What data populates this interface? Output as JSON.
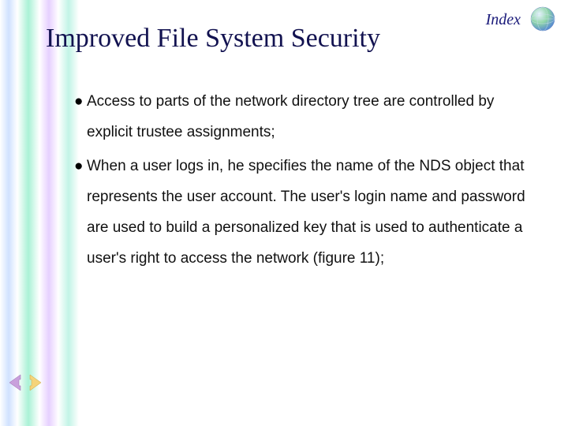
{
  "header": {
    "index_label": "Index",
    "title": "Improved File System Security"
  },
  "bullets": [
    "Access to parts of the network directory tree are controlled by explicit trustee assignments;",
    "When a user logs in, he specifies the name of the NDS object that represents the user account. The user's login name and password are used to build a personalized key that is used to authenticate a user's right to access the network (figure 11);"
  ]
}
